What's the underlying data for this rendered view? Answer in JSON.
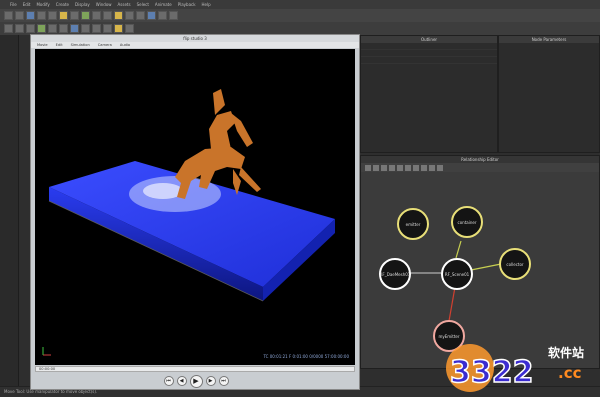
{
  "menubar": {
    "items": [
      "File",
      "Edit",
      "Modify",
      "Create",
      "Display",
      "Window",
      "Assets",
      "Select",
      "Animate",
      "Playback",
      "Help"
    ]
  },
  "outliner": {
    "title": "Outliner"
  },
  "attribute_editor": {
    "title": "Node Parameters"
  },
  "relationship_editor": {
    "title": "Relationship Editor",
    "nodes": [
      {
        "label": "emitter",
        "color": "#e8df78"
      },
      {
        "label": "container",
        "color": "#e8df78"
      },
      {
        "label": "collector",
        "color": "#e8df78"
      },
      {
        "label": "RF_DaeMesh01",
        "color": "#ffffff"
      },
      {
        "label": "RF_Scene01",
        "color": "#ffffff"
      },
      {
        "label": "myEmitter",
        "color": "#f0a8a0"
      }
    ]
  },
  "flip_window": {
    "title": "flip studio 3",
    "menu": [
      "Movie",
      "Edit",
      "Simulation",
      "Camera",
      "Audio"
    ],
    "timecode": "TC 00:01:21  F 0:01:00  0/0000  57:00:00:00",
    "timeline_label": "00:00:00"
  },
  "status_bar": {
    "text": "Move Tool: Use manipulator to move object(s)."
  },
  "watermark": {
    "text": "3322",
    "site": "软件站",
    "domain": ".cc"
  }
}
